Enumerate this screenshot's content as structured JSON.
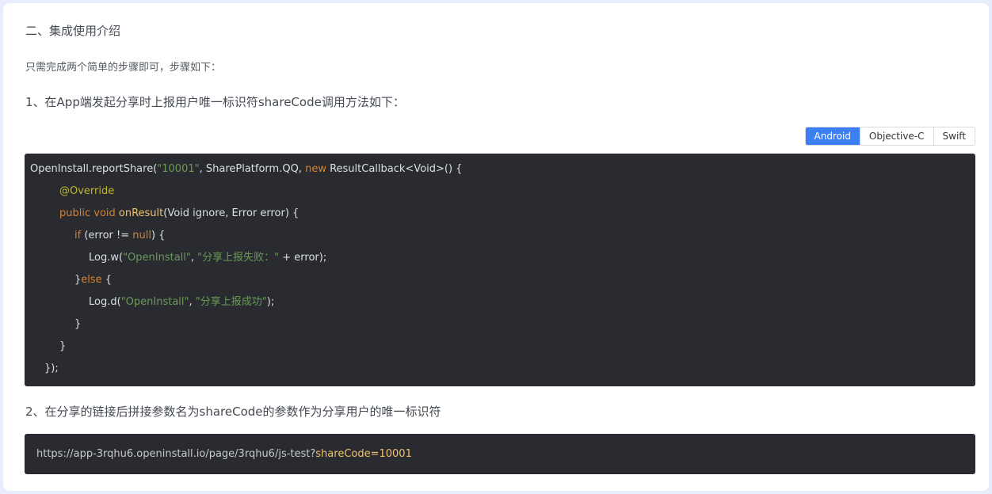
{
  "section_title": "二、集成使用介绍",
  "intro": "只需完成两个简单的步骤即可，步骤如下：",
  "step1": "1、在App端发起分享时上报用户唯一标识符shareCode调用方法如下：",
  "step2": "2、在分享的链接后拼接参数名为shareCode的参数作为分享用户的唯一标识符",
  "tabs": {
    "items": [
      "Android",
      "Objective-C",
      "Swift"
    ],
    "active_index": 0
  },
  "code": {
    "lines": [
      {
        "indent": 0,
        "tokens": [
          {
            "t": "OpenInstall.reportShare(",
            "k": "plain"
          },
          {
            "t": "\"10001\"",
            "k": "str"
          },
          {
            "t": ", SharePlatform.QQ, ",
            "k": "plain"
          },
          {
            "t": "new",
            "k": "kw"
          },
          {
            "t": " ResultCallback<Void>() {",
            "k": "plain"
          }
        ]
      },
      {
        "indent": 37,
        "tokens": [
          {
            "t": "@Override",
            "k": "ann"
          }
        ]
      },
      {
        "indent": 37,
        "tokens": [
          {
            "t": "public void ",
            "k": "kw"
          },
          {
            "t": "onResult",
            "k": "fn"
          },
          {
            "t": "(Void ignore, Error error) {",
            "k": "plain"
          }
        ]
      },
      {
        "indent": 56,
        "tokens": [
          {
            "t": "if",
            "k": "kw"
          },
          {
            "t": " (error != ",
            "k": "plain"
          },
          {
            "t": "null",
            "k": "kw"
          },
          {
            "t": ") {",
            "k": "plain"
          }
        ]
      },
      {
        "indent": 74,
        "tokens": [
          {
            "t": "Log.w(",
            "k": "plain"
          },
          {
            "t": "\"OpenInstall\"",
            "k": "str"
          },
          {
            "t": ", ",
            "k": "plain"
          },
          {
            "t": "\"分享上报失败：\"",
            "k": "str"
          },
          {
            "t": " + error);",
            "k": "plain"
          }
        ]
      },
      {
        "indent": 56,
        "tokens": [
          {
            "t": "}",
            "k": "plain"
          },
          {
            "t": "else",
            "k": "kw"
          },
          {
            "t": " {",
            "k": "plain"
          }
        ]
      },
      {
        "indent": 74,
        "tokens": [
          {
            "t": "Log.d(",
            "k": "plain"
          },
          {
            "t": "\"OpenInstall\"",
            "k": "str"
          },
          {
            "t": ", ",
            "k": "plain"
          },
          {
            "t": "\"分享上报成功\"",
            "k": "str"
          },
          {
            "t": ");",
            "k": "plain"
          }
        ]
      },
      {
        "indent": 56,
        "tokens": [
          {
            "t": "}",
            "k": "plain"
          }
        ]
      },
      {
        "indent": 37,
        "tokens": [
          {
            "t": "}",
            "k": "plain"
          }
        ]
      },
      {
        "indent": 18,
        "tokens": [
          {
            "t": "});",
            "k": "plain"
          }
        ]
      }
    ]
  },
  "url": {
    "base": "https://app-3rqhu6.openinstall.io/page/3rqhu6/js-test?",
    "param": "shareCode=10001"
  },
  "colors": {
    "code_bg": "#292b30",
    "string": "#6a9a56",
    "keyword": "#d9822b",
    "annotation": "#c3b42f",
    "function": "#f0c26b",
    "tab_active": "#3b7ff3"
  }
}
